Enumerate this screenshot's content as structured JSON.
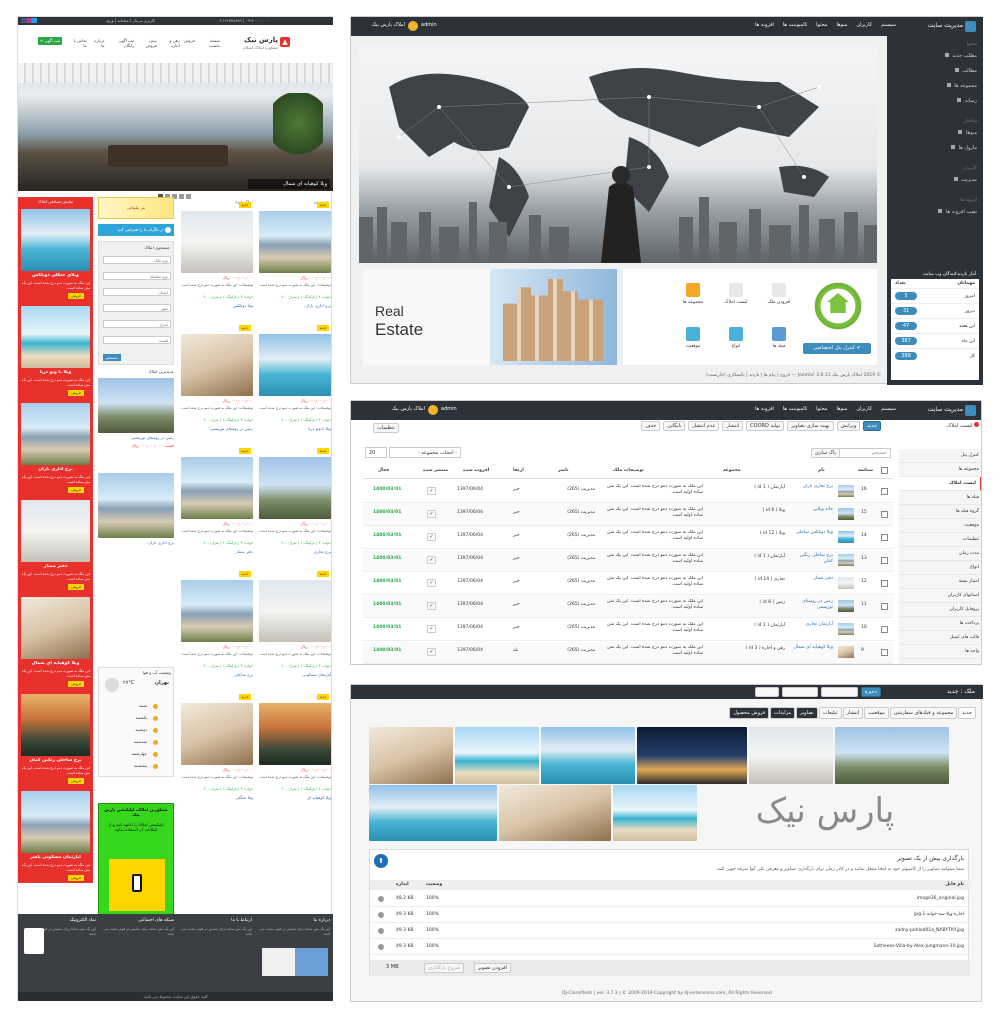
{
  "site": {
    "logo_title": "پارس نیک",
    "logo_sub": "مشاوره املاک اشکان",
    "new_ad_btn": "+ ثبت آگهی",
    "topbar_left": "کاربری تی‌ماز / سامانه | ورود",
    "topbar_right": "۰۲۱۶۶۷۷۸۸۹۹ | ۰۹۱۲۰۰۰۰۰۰۰",
    "nav": [
      "صفحه نخست",
      "فروش",
      "رهن و اجاره",
      "پیش فروش",
      "ثبت آگهی رایگان",
      "درباره ما",
      "تماس با ما"
    ],
    "hero_caption": "ویلا کوهپایه ای شمال",
    "hero_dots": [
      "1",
      "2",
      "3",
      "4",
      "5"
    ],
    "section_latest": "جدیدترین",
    "section_featured": "ملک ویژه",
    "right_header": "نمایش تصادفی املاک",
    "featured_items": [
      "ویلای جنگلی دوبلکس",
      "ویلا با ویو دریا",
      "برج اداری باران",
      "دفتر ممتاز",
      "ویلا کوهپایه ای شمال",
      "برج ساحلی رنگین کمان",
      "آپارتمان مسکونی پاسر"
    ],
    "featured_desc": "این ملک به صورت دمو درج شده است. این یک متن ساده است.",
    "price_label": "قیمت: ۰۰۰٫۰۰۰٫۰۰۰ ریال",
    "listing_titles": [
      "برج اداری باران",
      "ویلا دوبلکس",
      "ویلا با ویو دریا",
      "زمین در روستای توریستی",
      "برج تجاری",
      "دفتر ممتاز",
      "آپارتمان مسکونی",
      "برج ساحلی",
      "ویلا کوهپایه ای",
      "ویلا جنگلی"
    ],
    "listing_desc": "توضیحات: این ملک به صورت دمو درج شده است",
    "listing_price": "۰۰۰٫۰۰۰٫۰۰۰ ریال",
    "listing_meta": "خواب: ۳ | پارکینگ: ۱ | متراژ: ۲۰۰",
    "badge_new": "جدید",
    "badge_sale": "فروش",
    "side_banner": "بنر تبلیغاتی",
    "telegram": "در تلگرام ما را همراهی کنید",
    "search_title": "جستجوی املاک",
    "search_fields": [
      "نوع ملک",
      "نوع معامله",
      "استان",
      "شهر",
      "متراژ",
      "قیمت"
    ],
    "search_btn": "جستجو",
    "latest_title": "جدیدترین املاک",
    "side_listings": [
      "زمین در روستای توریستی",
      "برج اداری باران"
    ],
    "weather_title": "وضعیت آب و هوا",
    "weather_city": "تهران",
    "weather_temp": "۲۷°C",
    "weather_days": [
      "شنبه",
      "یکشنبه",
      "دوشنبه",
      "سه‌شنبه",
      "چهارشنبه",
      "پنجشنبه"
    ],
    "app_title": "مشاورین املاک، اپلیکیشن پارس نیک",
    "app_desc": "اپلیکیشن املاک را دانلود کنید و از امکانات آن استفاده نمایید",
    "footer_cols": [
      "درباره ما",
      "ارتباط با ما",
      "شبکه های اجتماعی",
      "نماد الکترونیک"
    ],
    "footer_text": "این یک متن ساده برای نمایش در فوتر سایت می باشد",
    "footer_copy": "کلیه حقوق این سایت محفوظ می باشد",
    "pagination": [
      "قبلی",
      "۱",
      "۲",
      "۳",
      "بعدی"
    ]
  },
  "admin1": {
    "brand": "مدیریت سایت",
    "menu": [
      "سیستم",
      "کاربران",
      "منوها",
      "محتوا",
      "کامپوننت ها",
      "افزونه ها"
    ],
    "site_link": "املاک پارس نیک",
    "user": "admin",
    "sidebar_headings": [
      "محتوا",
      "ساختار",
      "کاربران",
      "افزونه ها"
    ],
    "sidebar_items": [
      "مطلب جدید",
      "مطالب",
      "مجموعه ها",
      "رسانه",
      "منوها",
      "ماژول ها",
      "مدیریت",
      "نصب افزونه ها"
    ],
    "real_estate_line1": "Real",
    "real_estate_line2": "Estate",
    "tiles": [
      "افزودن ملک",
      "لیست املاک",
      "مجموعه ها",
      "فیلد ها",
      "انواع",
      "موقعیت"
    ],
    "cpanel_btn": "✔ کنترل پنل اختصاصی",
    "stats_title": "آمار بازدیدکنندگان وب سایت",
    "stats_head_visitors": "مهمانان",
    "stats_head_count": "تعداد",
    "stats_rows": [
      {
        "label": "امروز",
        "count": "5"
      },
      {
        "label": "دیروز",
        "count": "31"
      },
      {
        "label": "این هفته",
        "count": "47"
      },
      {
        "label": "این ماه",
        "count": "387"
      },
      {
        "label": "کل",
        "count": "388"
      }
    ],
    "footer": "© 2019 املاک پارس نیک Joomla! 3.8.11 — خروج | پیام ها | بازدید | پالسکاری (خاریست)"
  },
  "admin2": {
    "brand": "مدیریت سایت",
    "menu": [
      "سیستم",
      "کاربران",
      "منوها",
      "محتوا",
      "کامپوننت ها",
      "افزونه ها"
    ],
    "site_link": "املاک پارس نیک",
    "user": "admin",
    "page_title": "لیست املاک",
    "toolbar": [
      "جدید",
      "ویرایش",
      "بهینه سازی تصاویر",
      "تولید COORD",
      "انتشار",
      "عدم انتشار",
      "بایگانی",
      "حذف",
      "تنظیمات"
    ],
    "search_placeholder": "جستجو",
    "clear_btn": "پاک سازی",
    "collection_select": "- انتخاب مجموعه -",
    "limit": "20",
    "sidebar": [
      "کنترل پنل",
      "مجموعه ها",
      "لیست املاک",
      "فیلد ها",
      "گروه فیلد ها",
      "موقعیت",
      "تنظیمات",
      "مدت زمان",
      "انواع",
      "امتیاز بسته",
      "استانهای کاربران",
      "پروفایل کاربران",
      "پرداخت ها",
      "قالب های ایمیل",
      "واحد ها"
    ],
    "columns": [
      "شناسه",
      "نام",
      "مجموعه",
      "توضیحات ملک",
      "ناشر",
      "ارتقا",
      "افزوده شده",
      "منتشر شده",
      "فعال"
    ],
    "rows": [
      {
        "id": "16",
        "name": "برج تجاری باران",
        "collection": "آپارتمان ( id 1 )",
        "publisher": "مدیریت (265)",
        "promo": "خیر",
        "added": "1397/06/04",
        "active": "1400/03/01"
      },
      {
        "id": "15",
        "name": "خانه ویلایی",
        "collection": "ویلا ( id 6 )",
        "publisher": "مدیریت (265)",
        "promo": "خیر",
        "added": "1397/06/04",
        "active": "1400/03/01"
      },
      {
        "id": "14",
        "name": "ویلا دوبلکس ساحلی",
        "collection": "ویلا ( id 12 )",
        "publisher": "مدیریت (265)",
        "promo": "خیر",
        "added": "1397/06/04",
        "active": "1400/03/01"
      },
      {
        "id": "13",
        "name": "برج ساحلی رنگین کمان",
        "collection": "آپارتمان ( id 1 )",
        "publisher": "مدیریت (265)",
        "promo": "خیر",
        "added": "1397/06/04",
        "active": "1400/03/01"
      },
      {
        "id": "12",
        "name": "دفتر ممتاز",
        "collection": "تجاری ( id 14 )",
        "publisher": "مدیریت (265)",
        "promo": "خیر",
        "added": "1397/06/04",
        "active": "1400/03/01"
      },
      {
        "id": "11",
        "name": "زمین در روستای توریستی",
        "collection": "زمین ( id 8 )",
        "publisher": "مدیریت (265)",
        "promo": "خیر",
        "added": "1397/06/04",
        "active": "1400/03/01"
      },
      {
        "id": "10",
        "name": "آپارتمان تجاری",
        "collection": "آپارتمان ( id 1 )",
        "publisher": "مدیریت (265)",
        "promo": "خیر",
        "added": "1397/06/04",
        "active": "1400/03/01"
      },
      {
        "id": "9",
        "name": "ویلا کوهپایه ای شمال",
        "collection": "رهن و اجاره ( id 3 )",
        "publisher": "مدیریت (265)",
        "promo": "بله",
        "added": "1397/06/04",
        "active": "1400/03/01"
      }
    ],
    "desc": "این ملک به صورت دمو درج شده است. این یک متن ساده اولیه است."
  },
  "admin3": {
    "title": "ملک : جدید",
    "toolbar": [
      "ذخیره",
      "ذخیره و بستن",
      "ذخیره و جدید",
      "انصراف"
    ],
    "tabs": [
      "جدید",
      "مجموعه و فیلدهای سفارشی",
      "موقعیت",
      "انتشار",
      "تبلیغات",
      "تصاویر",
      "مزایدات",
      "فروش محصول"
    ],
    "watermark": "پارس نیک",
    "upload_title": "بارگذاری بیش از یک تصویر",
    "upload_desc": "شما میتوانید تصاویر را از کامپیوتر خود به اینجا منتقل نمایید و در کادر زمان برای بارگذاری تصاویر و معرفی تکی آنها صرفه جویی کنید.",
    "cols": [
      "نام فایل",
      "اندازه",
      "وضعیت"
    ],
    "files": [
      {
        "name": "image36_original.jpg",
        "size": "48.2 KB",
        "status": "100%"
      },
      {
        "name": "اجاره-ویلا-سه-خوابه-1.jpg",
        "size": "49.3 KB",
        "status": "100%"
      },
      {
        "name": "zadny-pohled01a_NABYTKY.jpg",
        "size": "49.3 KB",
        "status": "100%"
      },
      {
        "name": "Sotheeas-Villa-by-Alex-Jungmann-10.jpg",
        "size": "49.3 KB",
        "status": "100%"
      }
    ],
    "add_btn": "افزودن تصویر",
    "start_btn": "شروع بارگذاری",
    "total": "3 MB",
    "footer": "DJ-Classifieds | ver. 3.7.3 | © 2009-2019 Copyright by dj-extensions.com, All Rights Reserved"
  },
  "colors": {
    "dark": "#2d3238",
    "blue": "#3c8dbc",
    "red": "#e8312d",
    "green": "#28a745",
    "yellow": "#ffd400",
    "lime": "#35d61b",
    "footer": "#3b3f44"
  }
}
